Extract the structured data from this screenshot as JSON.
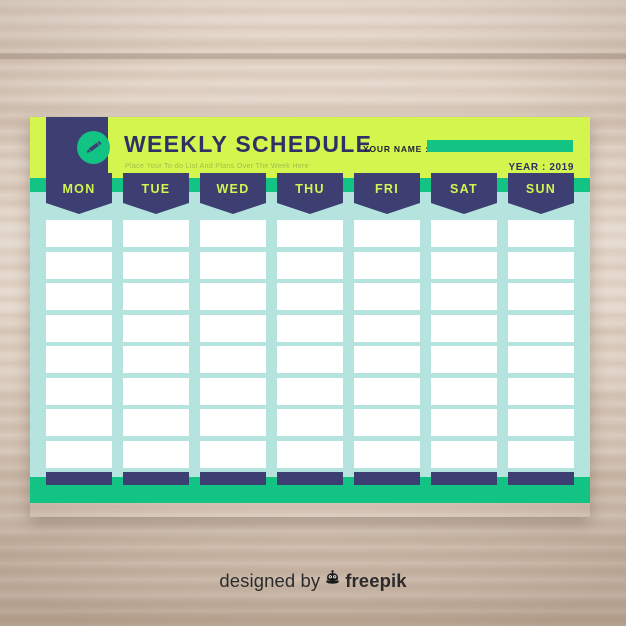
{
  "background": {
    "surface": "wood-desk",
    "color": "#e2d3c5"
  },
  "sheet": {
    "palette": {
      "lime": "#d4f54e",
      "navy": "#3d3e72",
      "green": "#13c383",
      "mint": "#b5e3dd",
      "white": "#ffffff",
      "title_navy": "#2f3066",
      "subtitle_olive": "#9fbf4a",
      "tab_label_lime": "#d4f54e"
    },
    "header": {
      "logo_icon": "pencil-icon",
      "title": "WEEKLY SCHEDULE",
      "subtitle": "Place Your To-do List And Plans Over The Week Here",
      "name_label": "YOUR NAME :",
      "name_value": "",
      "year_text": "YEAR : 2019"
    },
    "days": [
      {
        "label": "MON"
      },
      {
        "label": "TUE"
      },
      {
        "label": "WED"
      },
      {
        "label": "THU"
      },
      {
        "label": "FRI"
      },
      {
        "label": "SAT"
      },
      {
        "label": "SUN"
      }
    ],
    "grid": {
      "rows": 8,
      "columns": 7,
      "cell_value": "",
      "footer_row_is_filled": true
    }
  },
  "credit": {
    "prefix": "designed by",
    "icon": "freepik-robot-icon",
    "brand": "freepik"
  }
}
